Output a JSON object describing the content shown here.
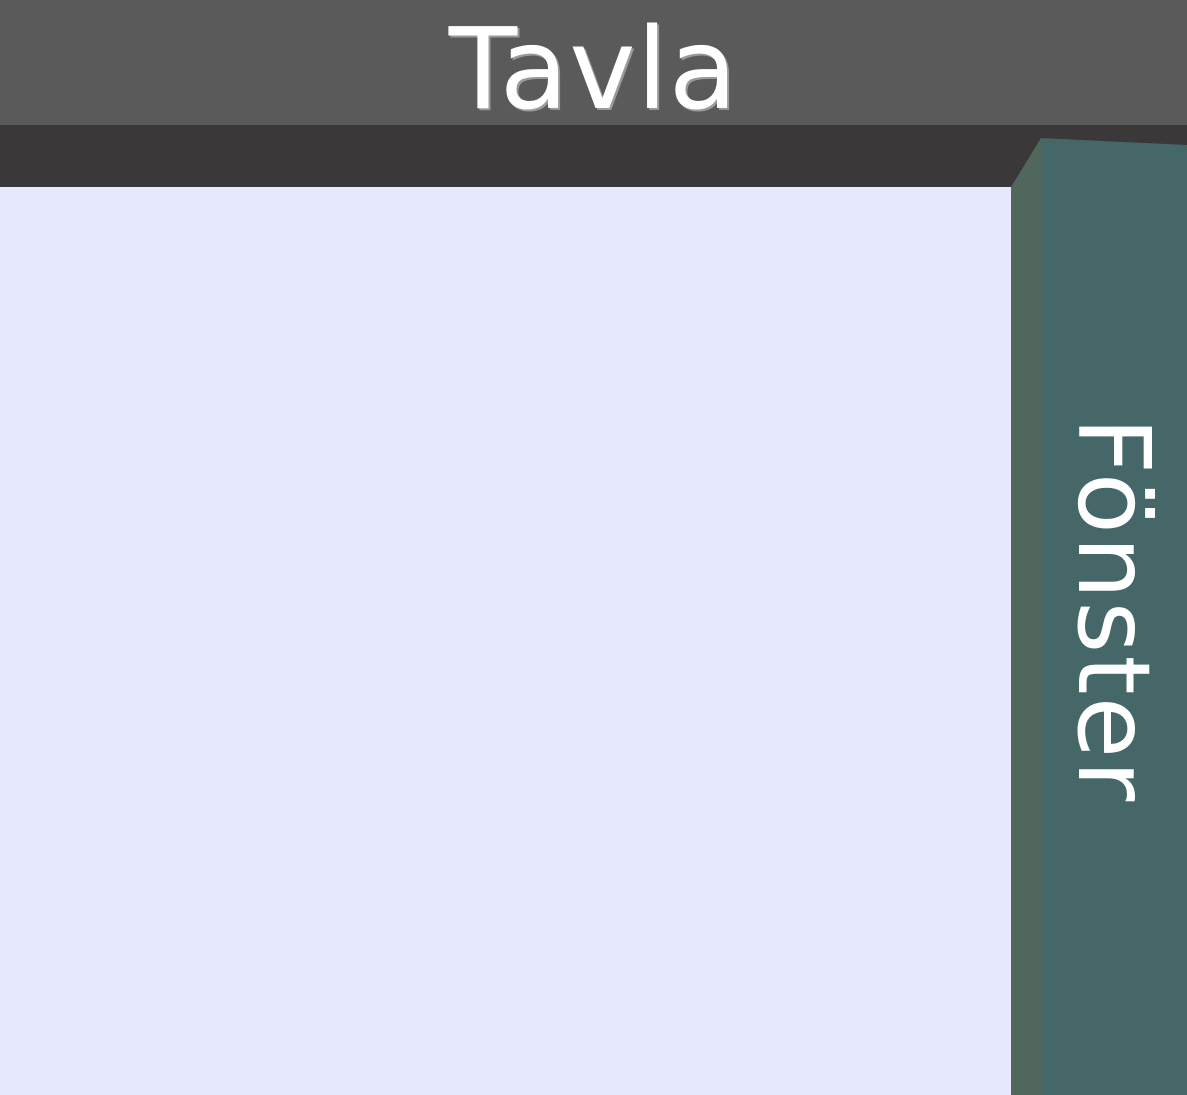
{
  "board": {
    "title": "Tavla"
  },
  "window": {
    "label": "Fönster"
  },
  "colors": {
    "board_header": "#5a5a5a",
    "board_ledge": "#3a3838",
    "board_surface": "#e6e8fd",
    "window_panel": "#456767",
    "window_edge": "#52675c",
    "text": "#ffffff"
  }
}
